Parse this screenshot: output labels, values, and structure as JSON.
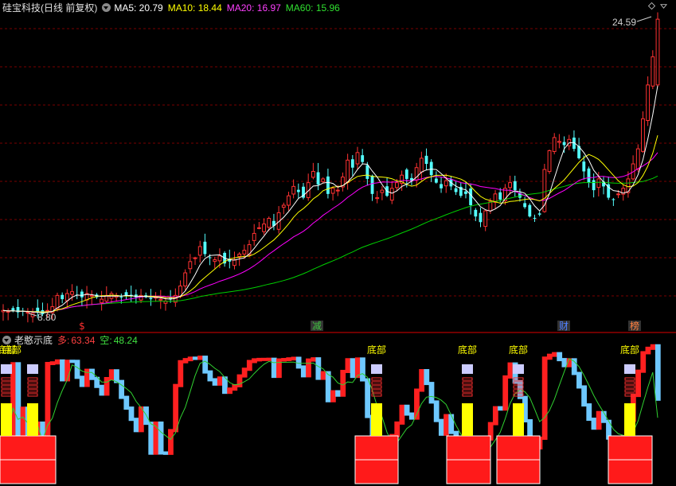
{
  "main_header": {
    "stock": "硅宝科技(日线 前复权)",
    "ma5": "MA5: 20.79",
    "ma10": "MA10: 18.44",
    "ma20": "MA20: 16.97",
    "ma60": "MA60: 15.96"
  },
  "indicator_header": {
    "name": "老憨示底",
    "long_label": "多:",
    "long_value": "63.34",
    "short_label": "空:",
    "short_value": "48.24"
  },
  "colors": {
    "up": "#ff3232",
    "down": "#54ffff",
    "ma5": "#ffffff",
    "ma10": "#ffff00",
    "ma20": "#ff00ff",
    "ma60": "#00d000",
    "grid": "#7a0000",
    "panel_border": "#b00000",
    "long_line": "#ff2020",
    "short_line": "#6ec8ff",
    "signal_yellow": "#ffff00",
    "signal_lavender": "#ccccff"
  },
  "markers": {
    "high": "24.59",
    "low": "8.80",
    "events": [
      {
        "label": "$",
        "color": "#ff3030"
      },
      {
        "label": "减",
        "color": "#40c040"
      },
      {
        "label": "财",
        "color": "#5080ff"
      },
      {
        "label": "榜",
        "color": "#ff8040"
      }
    ],
    "signal_text": "底部"
  },
  "chart_data": [
    {
      "type": "candlestick",
      "title": "硅宝科技(日线 前复权)",
      "ylim": [
        8.0,
        25.5
      ],
      "series": [
        {
          "name": "MA5",
          "last": 20.79
        },
        {
          "name": "MA10",
          "last": 18.44
        },
        {
          "name": "MA20",
          "last": 16.97
        },
        {
          "name": "MA60",
          "last": 15.96
        }
      ],
      "close": [
        9.0,
        8.95,
        9.0,
        8.9,
        8.95,
        8.9,
        8.85,
        8.9,
        8.8,
        9.0,
        9.2,
        9.8,
        9.6,
        9.9,
        10.0,
        9.8,
        9.7,
        9.9,
        9.8,
        9.7,
        9.6,
        9.8,
        9.9,
        9.8,
        9.7,
        9.8,
        9.75,
        9.7,
        9.8,
        9.7,
        9.6,
        9.7,
        9.6,
        9.5,
        9.6,
        9.8,
        10.3,
        11.0,
        11.6,
        11.8,
        12.4,
        12.0,
        11.8,
        11.7,
        11.9,
        11.5,
        11.6,
        11.7,
        12.0,
        12.2,
        12.5,
        13.1,
        13.4,
        13.6,
        13.9,
        13.5,
        14.2,
        14.6,
        15.1,
        15.6,
        15.3,
        15.0,
        15.8,
        16.4,
        15.7,
        16.0,
        15.2,
        15.5,
        15.4,
        16.1,
        17.0,
        16.6,
        17.4,
        16.9,
        16.0,
        15.2,
        15.0,
        15.4,
        15.1,
        15.5,
        15.8,
        16.2,
        16.0,
        15.9,
        16.6,
        17.1,
        16.8,
        16.2,
        15.8,
        15.5,
        15.9,
        15.6,
        15.3,
        15.1,
        15.2,
        14.6,
        14.0,
        13.7,
        14.3,
        14.8,
        15.2,
        14.9,
        15.5,
        15.8,
        15.4,
        15.0,
        14.5,
        14.0,
        13.9,
        14.1,
        16.5,
        17.5,
        18.2,
        18.0,
        17.8,
        18.1,
        17.6,
        17.1,
        16.4,
        15.8,
        15.4,
        16.0,
        15.6,
        15.0,
        14.9,
        15.2,
        15.5,
        16.0,
        16.8,
        17.6,
        19.2,
        21.0,
        22.5,
        24.5
      ],
      "low_marker": 8.8,
      "high_marker": 24.59
    },
    {
      "type": "line",
      "title": "老憨示底",
      "ylim": [
        0,
        100
      ],
      "series": [
        {
          "name": "多",
          "last": 63.34
        },
        {
          "name": "空",
          "last": 48.24
        }
      ]
    }
  ]
}
